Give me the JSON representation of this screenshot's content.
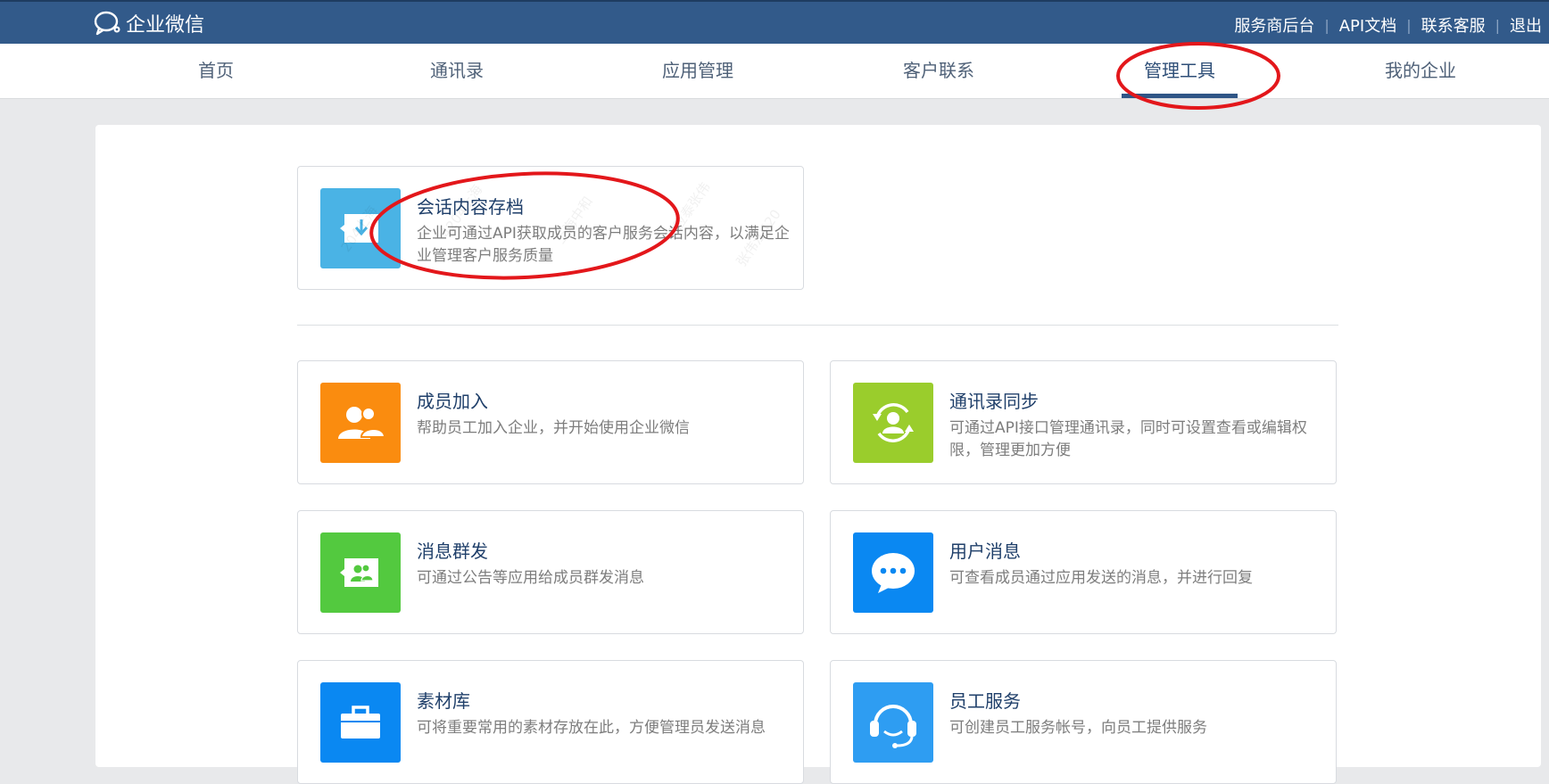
{
  "header": {
    "logo_text": "企业微信",
    "links": [
      "服务商后台",
      "API文档",
      "联系客服",
      "退出"
    ],
    "bg_color": "#325a8a"
  },
  "nav": {
    "items": [
      "首页",
      "通讯录",
      "应用管理",
      "客户联系",
      "管理工具",
      "我的企业"
    ],
    "active": "管理工具"
  },
  "featured": {
    "title": "会话内容存档",
    "desc": "企业可通过API获取成员的客户服务会话内容，以满足企业管理客户服务质量",
    "icon": "archive-download-icon",
    "color": "#4ab3e5"
  },
  "tools": [
    {
      "title": "成员加入",
      "desc": "帮助员工加入企业，并开始使用企业微信",
      "icon": "members-icon",
      "color": "#fa8c0f"
    },
    {
      "title": "通讯录同步",
      "desc": "可通过API接口管理通讯录，同时可设置查看或编辑权限，管理更加方便",
      "icon": "contact-sync-icon",
      "color": "#9acd2c"
    },
    {
      "title": "消息群发",
      "desc": "可通过公告等应用给成员群发消息",
      "icon": "group-message-icon",
      "color": "#53c93f"
    },
    {
      "title": "用户消息",
      "desc": "可查看成员通过应用发送的消息，并进行回复",
      "icon": "chat-bubble-icon",
      "color": "#0a88f2"
    },
    {
      "title": "素材库",
      "desc": "可将重要常用的素材存放在此，方便管理员发送消息",
      "icon": "briefcase-icon",
      "color": "#0a88f2"
    },
    {
      "title": "员工服务",
      "desc": "可创建员工服务帐号，向员工提供服务",
      "icon": "headset-icon",
      "color": "#2e9df2"
    }
  ]
}
